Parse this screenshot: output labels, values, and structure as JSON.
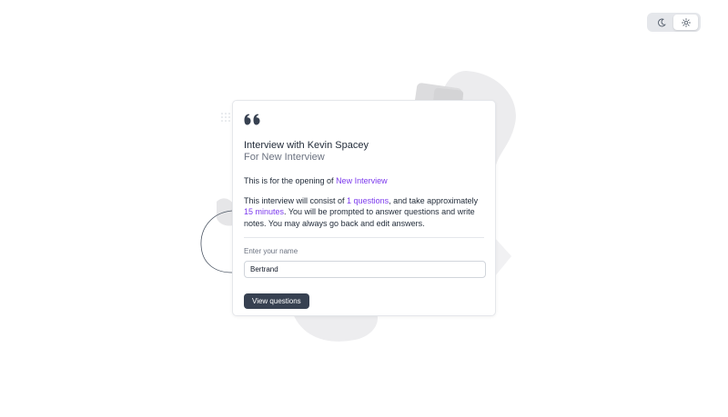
{
  "theme_toggle": {
    "options": [
      {
        "icon": "moon-icon",
        "active": false
      },
      {
        "icon": "sun-icon",
        "active": true
      }
    ]
  },
  "card": {
    "quote_icon": "quote-icon",
    "title": "Interview with Kevin Spacey",
    "subtitle": "For New Interview",
    "opening": {
      "prefix": "This is for the opening of ",
      "link": "New Interview"
    },
    "description": {
      "part1": "This interview will consist of ",
      "questions": "1 questions",
      "part2": ", and take approximately ",
      "minutes": "15 minutes",
      "part3": ". You will be prompted to answer questions and write notes. You may always go back and edit answers."
    },
    "name_field": {
      "label": "Enter your name",
      "value": "Bertrand",
      "placeholder": ""
    },
    "view_button": "View questions"
  },
  "colors": {
    "accent": "#7c3aed",
    "button": "#374151",
    "border": "#e5e7eb"
  }
}
